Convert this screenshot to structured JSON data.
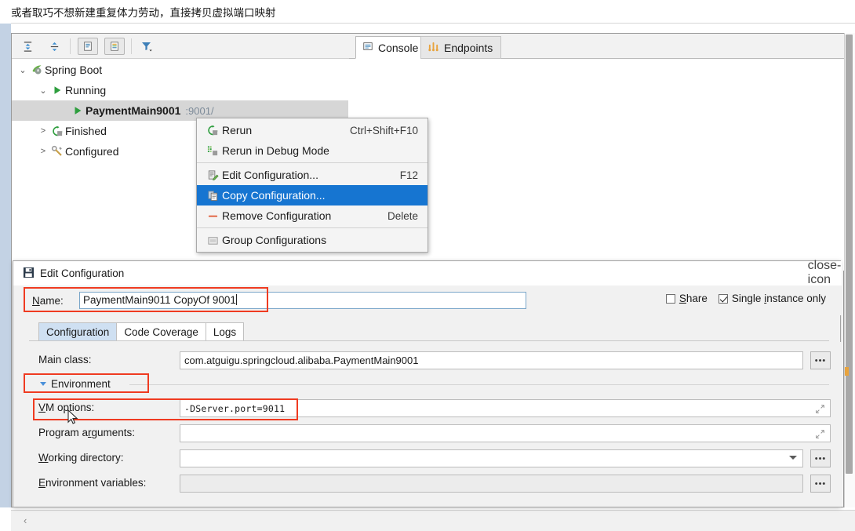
{
  "caption": {
    "text": "或者取巧不想新建重复体力劳动，直接拷贝虚拟端口映射"
  },
  "run_panel": {
    "toolbar": {
      "buttons": [
        {
          "name": "expand-all-icon",
          "tooltip": "Expand All"
        },
        {
          "name": "collapse-all-icon",
          "tooltip": "Collapse All"
        },
        {
          "name": "show-console-icon",
          "tooltip": "Show Console"
        },
        {
          "name": "show-test-output-icon",
          "tooltip": "Show Output"
        },
        {
          "name": "filter-icon",
          "tooltip": "Filter"
        }
      ]
    },
    "tree": [
      {
        "chevron": "⌄",
        "icon": "spring-boot-icon",
        "label": "Spring Boot",
        "indent": 0,
        "bold": false,
        "selected": false,
        "sub": ""
      },
      {
        "chevron": "⌄",
        "icon": "run-green-icon",
        "label": "Running",
        "indent": 1,
        "bold": false,
        "selected": false,
        "sub": ""
      },
      {
        "chevron": "",
        "icon": "run-green-icon",
        "label": "PaymentMain9001",
        "indent": 2,
        "bold": true,
        "selected": true,
        "sub": ":9001/"
      },
      {
        "chevron": ">",
        "icon": "rerun-icon",
        "label": "Finished",
        "indent": 1,
        "bold": false,
        "selected": false,
        "sub": ""
      },
      {
        "chevron": ">",
        "icon": "wrench-icon",
        "label": "Configured",
        "indent": 1,
        "bold": false,
        "selected": false,
        "sub": ""
      }
    ],
    "tabs": [
      {
        "label": "Console",
        "icon": "console-icon",
        "active": true
      },
      {
        "label": "Endpoints",
        "icon": "endpoints-icon",
        "active": false
      }
    ]
  },
  "context_menu": {
    "items": [
      {
        "label": "Rerun",
        "shortcut": "Ctrl+Shift+F10",
        "icon": "rerun-icon",
        "highlighted": false,
        "separator_after": false
      },
      {
        "label": "Rerun in Debug Mode",
        "shortcut": "",
        "icon": "debug-rerun-icon",
        "highlighted": false,
        "separator_after": true
      },
      {
        "label": "Edit Configuration...",
        "shortcut": "F12",
        "icon": "edit-configuration-icon",
        "highlighted": false,
        "separator_after": false
      },
      {
        "label": "Copy Configuration...",
        "shortcut": "",
        "icon": "copy-configuration-icon",
        "highlighted": true,
        "separator_after": false
      },
      {
        "label": "Remove Configuration",
        "shortcut": "Delete",
        "icon": "remove-minus-icon",
        "highlighted": false,
        "separator_after": true
      },
      {
        "label": "Group Configurations",
        "shortcut": "",
        "icon": "group-folder-icon",
        "highlighted": false,
        "separator_after": false
      }
    ]
  },
  "dialog": {
    "title": "Edit Configuration",
    "title_icon": "intellij-save-icon",
    "close_icon": "close-icon",
    "name_label": "Name:",
    "name_value": "PaymentMain9011 CopyOf 9001",
    "share": {
      "label": "Share",
      "checked": false
    },
    "single_instance": {
      "label": "Single instance only",
      "checked": true
    },
    "tabs": [
      {
        "label": "Configuration",
        "active": true
      },
      {
        "label": "Code Coverage",
        "active": false
      },
      {
        "label": "Logs",
        "active": false
      }
    ],
    "fields": [
      {
        "label": "Main class:",
        "value": "com.atguigu.springcloud.alibaba.PaymentMain9001",
        "kind": "text",
        "disabled": false,
        "trailing": "dots",
        "mono": false
      },
      {
        "label": "VM options:",
        "value": "-DServer.port=9011",
        "kind": "text",
        "disabled": false,
        "trailing": "expand",
        "mono": true
      },
      {
        "label": "Program arguments:",
        "value": "",
        "kind": "text",
        "disabled": false,
        "trailing": "expand",
        "mono": false
      },
      {
        "label": "Working directory:",
        "value": "",
        "kind": "combo",
        "disabled": false,
        "trailing": "chevron-dots",
        "mono": false
      },
      {
        "label": "Environment variables:",
        "value": "",
        "kind": "text",
        "disabled": true,
        "trailing": "dots",
        "mono": false
      }
    ],
    "environment_section": {
      "label": "Environment",
      "expanded": true
    },
    "dots_label": "•••"
  },
  "bottom": {
    "chevron": "‹"
  },
  "colors": {
    "accent_blue": "#1675d1",
    "annotation_red": "#ef3b21",
    "selection_grey": "#d6d6d6",
    "tab_active_blue": "#cfe0f2",
    "green": "#43a047",
    "orange": "#e8a33d"
  }
}
